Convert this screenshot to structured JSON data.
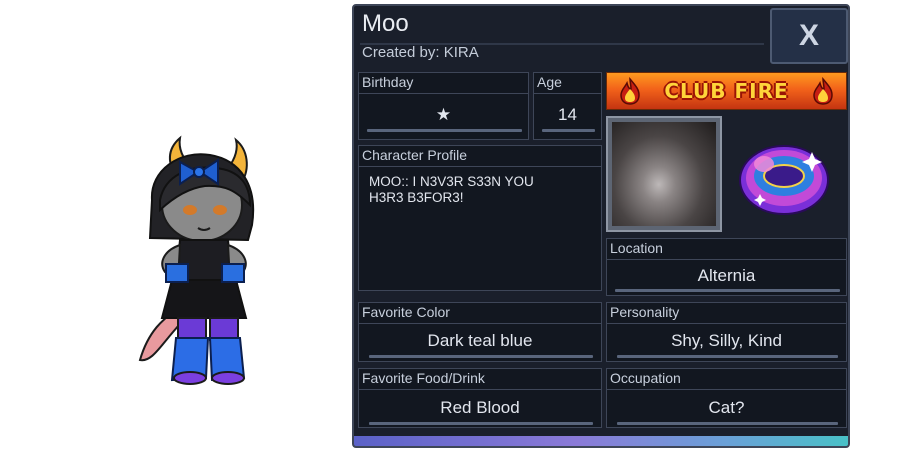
{
  "profile": {
    "name": "Moo",
    "created_by_label": "Created by:",
    "creator": "KIRA",
    "close_label": "X"
  },
  "fields": {
    "birthday": {
      "label": "Birthday",
      "value": "★"
    },
    "age": {
      "label": "Age",
      "value": "14"
    },
    "character_profile": {
      "label": "Character Profile",
      "text": "MOO:: I N3V3R S33N YOU\nH3R3 B3FOR3!"
    },
    "location": {
      "label": "Location",
      "value": "Alternia"
    },
    "favorite_color": {
      "label": "Favorite Color",
      "value": "Dark teal blue"
    },
    "personality": {
      "label": "Personality",
      "value": "Shy, Silly, Kind"
    },
    "favorite_food": {
      "label": "Favorite Food/Drink",
      "value": "Red Blood"
    },
    "occupation": {
      "label": "Occupation",
      "value": "Cat?"
    }
  },
  "club": {
    "name": "CLUB FIRE",
    "icon": "flame-icon"
  },
  "colors": {
    "panel_bg": "#1a1f2b",
    "box_bg": "#121720",
    "border": "#3e4658",
    "club_orange": "#f2621a",
    "club_text": "#ffd43a"
  }
}
